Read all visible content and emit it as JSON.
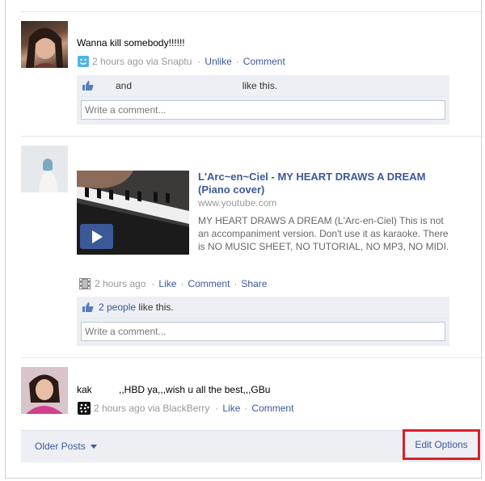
{
  "stories": [
    {
      "message": "Wanna kill somebody!!!!!!",
      "time": "2 hours ago via Snaptu",
      "actions": [
        "Unlike",
        "Comment"
      ],
      "likes_text": "and                                         like this.",
      "comment_placeholder": "Write a comment..."
    },
    {
      "attachment_title": "L'Arc~en~Ciel - MY HEART DRAWS A DREAM (Piano cover)",
      "attachment_url": "www.youtube.com",
      "attachment_desc": "MY HEART DRAWS A DREAM (L'Arc-en-Ciel) This is not an accompaniment version. Don't use it as karaoke. There is NO MUSIC SHEET, NO TUTORIAL, NO MP3, NO MIDI.",
      "time": "2 hours ago",
      "actions": [
        "Like",
        "Comment",
        "Share"
      ],
      "likes_link": "2 people",
      "likes_suffix": " like this.",
      "comment_placeholder": "Write a comment..."
    },
    {
      "message": "kak          ,,HBD ya,,,wish u all the best,,,GBu",
      "time": "2 hours ago via BlackBerry",
      "actions": [
        "Like",
        "Comment"
      ]
    }
  ],
  "footer": {
    "older_posts": "Older Posts",
    "edit_options": "Edit Options"
  },
  "colors": {
    "link": "#3b5998",
    "highlight_box": "#d81f2a",
    "ufi_background": "#edeff4"
  }
}
